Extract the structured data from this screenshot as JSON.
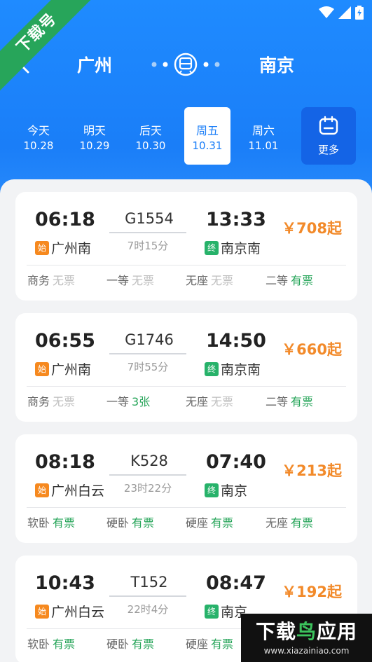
{
  "header": {
    "from_city": "广州",
    "to_city": "南京"
  },
  "ribbon": {
    "text": "下载号"
  },
  "dates": [
    {
      "weekday": "今天",
      "date": "10.28",
      "selected": false
    },
    {
      "weekday": "明天",
      "date": "10.29",
      "selected": false
    },
    {
      "weekday": "后天",
      "date": "10.30",
      "selected": false
    },
    {
      "weekday": "周五",
      "date": "10.31",
      "selected": true
    },
    {
      "weekday": "周六",
      "date": "11.01",
      "selected": false
    }
  ],
  "more_label": "更多",
  "tags": {
    "start": "始",
    "end": "终"
  },
  "trains": [
    {
      "dep_time": "06:18",
      "dep_station": "广州南",
      "train_no": "G1554",
      "duration": "7时15分",
      "arr_time": "13:33",
      "arr_station": "南京南",
      "price": "￥708起",
      "seats": [
        {
          "name": "商务",
          "value": "无票",
          "status": "none"
        },
        {
          "name": "一等",
          "value": "无票",
          "status": "none"
        },
        {
          "name": "无座",
          "value": "无票",
          "status": "none"
        },
        {
          "name": "二等",
          "value": "有票",
          "status": "avail"
        }
      ]
    },
    {
      "dep_time": "06:55",
      "dep_station": "广州南",
      "train_no": "G1746",
      "duration": "7时55分",
      "arr_time": "14:50",
      "arr_station": "南京南",
      "price": "￥660起",
      "seats": [
        {
          "name": "商务",
          "value": "无票",
          "status": "none"
        },
        {
          "name": "一等",
          "value": "3张",
          "status": "avail"
        },
        {
          "name": "无座",
          "value": "无票",
          "status": "none"
        },
        {
          "name": "二等",
          "value": "有票",
          "status": "avail"
        }
      ]
    },
    {
      "dep_time": "08:18",
      "dep_station": "广州白云",
      "train_no": "K528",
      "duration": "23时22分",
      "arr_time": "07:40",
      "arr_station": "南京",
      "price": "￥213起",
      "seats": [
        {
          "name": "软卧",
          "value": "有票",
          "status": "avail"
        },
        {
          "name": "硬卧",
          "value": "有票",
          "status": "avail"
        },
        {
          "name": "硬座",
          "value": "有票",
          "status": "avail"
        },
        {
          "name": "无座",
          "value": "有票",
          "status": "avail"
        }
      ]
    },
    {
      "dep_time": "10:43",
      "dep_station": "广州白云",
      "train_no": "T152",
      "duration": "22时4分",
      "arr_time": "08:47",
      "arr_station": "南京",
      "price": "￥192起",
      "seats": [
        {
          "name": "软卧",
          "value": "有票",
          "status": "avail"
        },
        {
          "name": "硬卧",
          "value": "有票",
          "status": "avail"
        },
        {
          "name": "硬座",
          "value": "有票",
          "status": "avail"
        }
      ]
    }
  ],
  "watermark": {
    "title_white": "下载",
    "title_green": "鸟",
    "title_tail": "应用",
    "url": "www.xiazainiao.com"
  },
  "colors": {
    "primary": "#1a7ef8",
    "price": "#f28a2a",
    "available": "#27a55a",
    "unavailable": "#bdbdbd"
  }
}
